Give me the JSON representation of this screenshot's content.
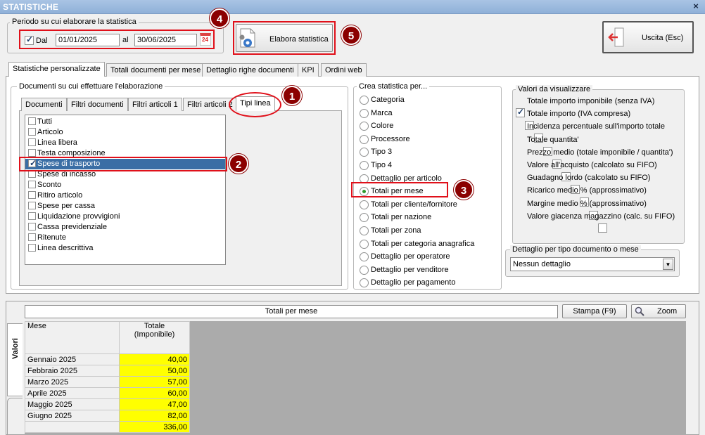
{
  "window": {
    "title": "STATISTICHE",
    "close": "×"
  },
  "period": {
    "legend": "Periodo su cui elaborare la statistica",
    "dal_label": "Dal",
    "dal_checked": true,
    "from": "01/01/2025",
    "al_label": "al",
    "to": "30/06/2025",
    "calendar_day": "24"
  },
  "buttons": {
    "elabora": "Elabora statistica",
    "uscita": "Uscita (Esc)",
    "stampa": "Stampa (F9)",
    "zoom": "Zoom"
  },
  "main_tabs": [
    "Statistiche personalizzate",
    "Totali documenti per mese",
    "Dettaglio righe documenti",
    "KPI",
    "Ordini web"
  ],
  "documents_group": {
    "legend": "Documenti su cui effettuare l'elaborazione",
    "tabs": [
      "Documenti",
      "Filtri documenti",
      "Filtri articoli 1",
      "Filtri articoli 2",
      "Tipi linea"
    ],
    "items": [
      {
        "label": "Tutti",
        "checked": false
      },
      {
        "label": "Articolo",
        "checked": false
      },
      {
        "label": "Linea libera",
        "checked": false
      },
      {
        "label": "Testa composizione",
        "checked": false
      },
      {
        "label": "Spese di trasporto",
        "checked": true
      },
      {
        "label": "Spese di incasso",
        "checked": false
      },
      {
        "label": "Sconto",
        "checked": false
      },
      {
        "label": "Ritiro articolo",
        "checked": false
      },
      {
        "label": "Spese per cassa",
        "checked": false
      },
      {
        "label": "Liquidazione provvigioni",
        "checked": false
      },
      {
        "label": "Cassa previdenziale",
        "checked": false
      },
      {
        "label": "Ritenute",
        "checked": false
      },
      {
        "label": "Linea descrittiva",
        "checked": false
      }
    ]
  },
  "crea": {
    "legend": "Crea statistica per...",
    "options": [
      "Categoria",
      "Marca",
      "Colore",
      "Processore",
      "Tipo 3",
      "Tipo 4",
      "Dettaglio per articolo",
      "Totali per mese",
      "Totali per cliente/fornitore",
      "Totali per nazione",
      "Totali per zona",
      "Totali per categoria anagrafica",
      "Dettaglio per operatore",
      "Dettaglio per venditore",
      "Dettaglio per pagamento"
    ],
    "selected": "Totali per mese"
  },
  "valori": {
    "legend": "Valori da visualizzare",
    "items": [
      {
        "label": "Totale importo imponibile (senza IVA)",
        "checked": true
      },
      {
        "label": "Totale importo (IVA compresa)",
        "checked": false
      },
      {
        "label": "Incidenza percentuale sull'importo totale",
        "checked": false
      },
      {
        "label": "Totale quantita'",
        "checked": false
      },
      {
        "label": "Prezzo medio (totale imponibile / quantita')",
        "checked": false
      },
      {
        "label": "Valore all'acquisto (calcolato su FIFO)",
        "checked": false
      },
      {
        "label": "Guadagno lordo (calcolato su FIFO)",
        "checked": false
      },
      {
        "label": "Ricarico medio % (approssimativo)",
        "checked": false
      },
      {
        "label": "Margine medio % (approssimativo)",
        "checked": false
      },
      {
        "label": "Valore giacenza magazzino (calc. su FIFO)",
        "checked": false
      }
    ]
  },
  "dettaglio": {
    "legend": "Dettaglio per tipo documento o mese",
    "value": "Nessun dettaglio"
  },
  "results": {
    "side_tab": "Valori",
    "title": "Totali per mese",
    "col_mese": "Mese",
    "col_totale_1": "Totale",
    "col_totale_2": "(Imponibile)",
    "rows": [
      {
        "mese": "Gennaio 2025",
        "valore": "40,00"
      },
      {
        "mese": "Febbraio 2025",
        "valore": "50,00"
      },
      {
        "mese": "Marzo 2025",
        "valore": "57,00"
      },
      {
        "mese": "Aprile 2025",
        "valore": "60,00"
      },
      {
        "mese": "Maggio 2025",
        "valore": "47,00"
      },
      {
        "mese": "Giugno 2025",
        "valore": "82,00"
      }
    ],
    "total": "336,00"
  },
  "badges": [
    "1",
    "2",
    "3",
    "4",
    "5"
  ],
  "colors": {
    "annotation_red": "#e0101a",
    "badge": "#8b0000",
    "highlight_yellow": "#ffff00",
    "selection": "#3a6ea5"
  }
}
